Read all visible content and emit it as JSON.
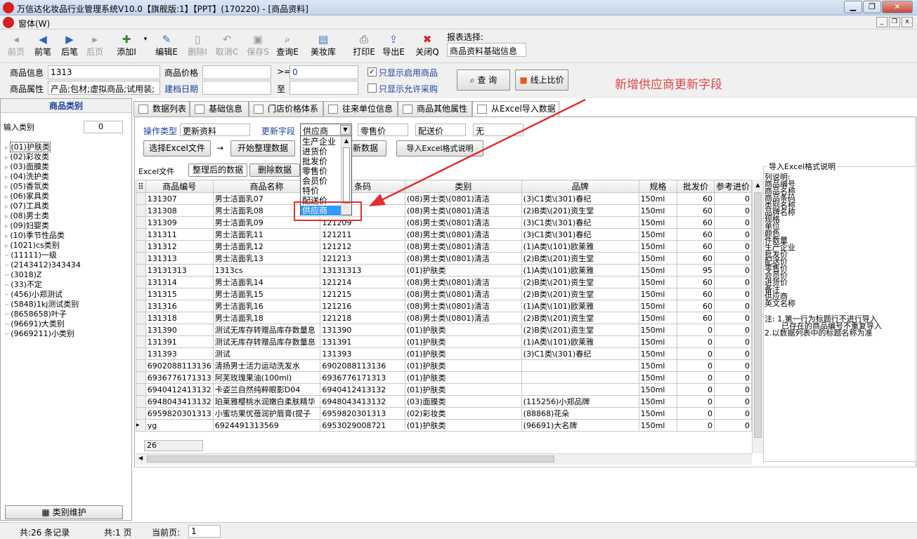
{
  "title": "万信达化妆品行业管理系统V10.0【旗舰版:1】【PPT】(170220) - [商品资料]",
  "menu": {
    "window": "窗体(W)"
  },
  "toolbar": {
    "items": [
      {
        "label": "前页",
        "icon": "prev-icon",
        "disabled": true
      },
      {
        "label": "前笔",
        "icon": "left-arrow-icon",
        "disabled": false
      },
      {
        "label": "后笔",
        "icon": "right-arrow-icon",
        "disabled": false
      },
      {
        "label": "后页",
        "icon": "next-icon",
        "disabled": true
      },
      {
        "label": "添加I",
        "icon": "add-icon",
        "disabled": false
      },
      {
        "label": "编辑E",
        "icon": "edit-icon",
        "disabled": false
      },
      {
        "label": "删除I",
        "icon": "delete-icon",
        "disabled": true
      },
      {
        "label": "取消C",
        "icon": "undo-icon",
        "disabled": true
      },
      {
        "label": "保存S",
        "icon": "save-icon",
        "disabled": true
      },
      {
        "label": "查询E",
        "icon": "query-icon",
        "disabled": false
      },
      {
        "label": "美妆库",
        "icon": "cosmetics-icon",
        "disabled": false
      },
      {
        "label": "打印E",
        "icon": "print-icon",
        "disabled": false
      },
      {
        "label": "导出E",
        "icon": "export-icon",
        "disabled": false
      },
      {
        "label": "关闭Q",
        "icon": "close-icon",
        "disabled": false
      }
    ],
    "report_label": "报表选择:",
    "report_value": "商品资料基础信息"
  },
  "search": {
    "info_label": "商品信息",
    "info_value": "1313",
    "price_label": "商品价格",
    "price_op": ">=",
    "price_value": "0",
    "attr_label": "商品属性",
    "attr_value": "产品;包材;虚拟商品;试用装;",
    "date_label": "建档日期",
    "date_to": "至",
    "show_enabled": "只显示启用商品",
    "show_purchase": "只显示允许采购",
    "query_btn": "查 询",
    "online_btn": "线上比价"
  },
  "note": "新增供应商更新字段",
  "left": {
    "header": "商品类别",
    "filter_label": "输入类别",
    "filter_count": "0",
    "tree": [
      "(01)护肤类",
      "(02)彩妆类",
      "(03)面膜类",
      "(04)洗护类",
      "(05)香氛类",
      "(06)家具类",
      "(07)工具类",
      "(08)男士类",
      "(09)妇婴类",
      "(10)季节性品类",
      "(1021)cs类别",
      "(11111)一级",
      "(2143412)343434",
      "(3018)Z",
      "(33)不定",
      "(456)小郑测试",
      "(5848)1kj测试类别",
      "(8658658)叶子",
      "(96691)大类别",
      "(9669211)小类别"
    ],
    "maintain_btn": "类别维护"
  },
  "tabs": [
    "数据列表",
    "基础信息",
    "门店价格体系",
    "往来单位信息",
    "商品其他属性",
    "从Excel导入数据"
  ],
  "import": {
    "op_type_label": "操作类型",
    "op_type_value": "更新资料",
    "update_field_label": "更新字段",
    "update_field_value": "供应商",
    "field2": "零售价",
    "field3": "配送价",
    "field4": "无",
    "select_excel_btn": "选择Excel文件",
    "arrow": "→",
    "start_btn": "开始整理数据",
    "update_btn": "新数据",
    "format_btn": "导入Excel格式说明",
    "tab_excel": "Excel文件",
    "tab_processed": "整理后的数据",
    "delete_btn": "删除数据"
  },
  "dropdown": {
    "items": [
      "生产企业",
      "进货价",
      "批发价",
      "零售价",
      "会员价",
      "特价",
      "配送价",
      "供应商"
    ],
    "selected": "供应商"
  },
  "table": {
    "headers": [
      "商品编号",
      "商品名称",
      "条码",
      "类别",
      "品牌",
      "规格",
      "批发价",
      "参考进价"
    ],
    "rows": [
      [
        "131307",
        "男士洁面乳07",
        "",
        "(08)男士类\\(0801)清洁",
        "(3)C1类\\(301)春纪",
        "150ml",
        "60",
        "0"
      ],
      [
        "131308",
        "男士洁面乳08",
        "",
        "(08)男士类\\(0801)清洁",
        "(2)B类\\(201)资生堂",
        "150ml",
        "60",
        "0"
      ],
      [
        "131309",
        "男士洁面乳09",
        "121209",
        "(08)男士类\\(0801)清洁",
        "(3)C1类\\(301)春纪",
        "150ml",
        "60",
        "0"
      ],
      [
        "131311",
        "男士洁面乳11",
        "121211",
        "(08)男士类\\(0801)清洁",
        "(3)C1类\\(301)春纪",
        "150ml",
        "60",
        "0"
      ],
      [
        "131312",
        "男士洁面乳12",
        "121212",
        "(08)男士类\\(0801)清洁",
        "(1)A类\\(101)欧莱雅",
        "150ml",
        "60",
        "0"
      ],
      [
        "131313",
        "男士洁面乳13",
        "121213",
        "(08)男士类\\(0801)清洁",
        "(2)B类\\(201)资生堂",
        "150ml",
        "60",
        "0"
      ],
      [
        "13131313",
        "1313cs",
        "13131313",
        "(01)护肤类",
        "(1)A类\\(101)欧莱雅",
        "150ml",
        "95",
        "0"
      ],
      [
        "131314",
        "男士洁面乳14",
        "121214",
        "(08)男士类\\(0801)清洁",
        "(2)B类\\(201)资生堂",
        "150ml",
        "60",
        "0"
      ],
      [
        "131315",
        "男士洁面乳15",
        "121215",
        "(08)男士类\\(0801)清洁",
        "(2)B类\\(201)资生堂",
        "150ml",
        "60",
        "0"
      ],
      [
        "131316",
        "男士洁面乳16",
        "121216",
        "(08)男士类\\(0801)清洁",
        "(1)A类\\(101)欧莱雅",
        "150ml",
        "60",
        "0"
      ],
      [
        "131318",
        "男士洁面乳18",
        "121218",
        "(08)男士类\\(0801)清洁",
        "(2)B类\\(201)资生堂",
        "150ml",
        "60",
        "0"
      ],
      [
        "131390",
        "测试无库存转赠品库存数量息",
        "131390",
        "(01)护肤类",
        "(2)B类\\(201)资生堂",
        "150ml",
        "0",
        "0"
      ],
      [
        "131391",
        "测试无库存转赠品库存数量息",
        "131391",
        "(01)护肤类",
        "(1)A类\\(101)欧莱雅",
        "150ml",
        "0",
        "0"
      ],
      [
        "131393",
        "测试",
        "131393",
        "(01)护肤类",
        "(3)C1类\\(301)春纪",
        "150ml",
        "0",
        "0"
      ],
      [
        "6902088113136",
        "清扬男士活力运动洗发水",
        "6902088113136",
        "(01)护肤类",
        "",
        "150ml",
        "0",
        "0"
      ],
      [
        "6936776171313",
        "阿芙玫瑰果油(100ml)",
        "6936776171313",
        "(01)护肤类",
        "",
        "150ml",
        "0",
        "0"
      ],
      [
        "6940412413132",
        "卡姿兰自然纯粹眼影D04",
        "6940412413132",
        "(01)护肤类",
        "",
        "150ml",
        "0",
        "0"
      ],
      [
        "6948043413132",
        "珀莱雅樱桃水润嫩白柔肤精华",
        "6948043413132",
        "(03)面膜类",
        "(115256)小郑品牌",
        "150ml",
        "0",
        "0"
      ],
      [
        "6959820301313",
        "小蜜坊果优蓓润护唇膏(提子",
        "6959820301313",
        "(02)彩妆类",
        "(88868)花朵",
        "150ml",
        "0",
        "0"
      ],
      [
        "yg",
        "6924491313569",
        "6953029008721",
        "(01)护肤类",
        "(96691)大名牌",
        "150ml",
        "0",
        "0"
      ]
    ],
    "row_count": "26"
  },
  "format": {
    "title": "导入Excel格式说明",
    "lines": [
      "列说明:",
      "商品编号",
      "商品名称",
      "商品条码",
      "类别名称",
      "品牌名称",
      "规格",
      "单位",
      "颜色",
      "件数量",
      "生产企业",
      "批发价",
      "配送价",
      "零售价",
      "会员价",
      "进货价",
      "备注",
      "供应商",
      "英文名称"
    ],
    "notes": [
      "注: 1.第一行为标题行不进行导入",
      "已存在的商品编号不重复导入",
      "2.以数据列表中的标题名称为准"
    ]
  },
  "status": {
    "records": "共:26 条记录",
    "pages": "共:1 页",
    "current_label": "当前页:",
    "current_value": "1"
  }
}
